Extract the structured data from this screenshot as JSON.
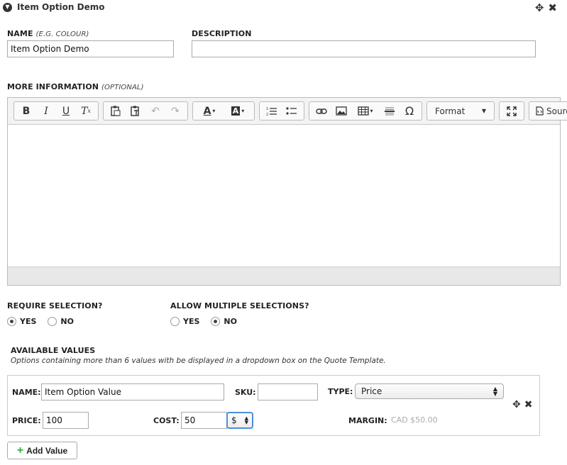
{
  "panel": {
    "title": "Item Option Demo",
    "move_icon": "✥",
    "close_icon": "✖"
  },
  "name_field": {
    "label": "NAME",
    "hint": "(E.G. COLOUR)",
    "value": "Item Option Demo"
  },
  "description_field": {
    "label": "DESCRIPTION",
    "value": ""
  },
  "more_info": {
    "label": "MORE INFORMATION",
    "hint": "(OPTIONAL)"
  },
  "toolbar": {
    "format_label": "Format",
    "source_label": "Source"
  },
  "require_selection": {
    "label": "REQUIRE SELECTION?",
    "yes": "YES",
    "no": "NO",
    "selected": "YES"
  },
  "allow_multiple": {
    "label": "ALLOW MULTIPLE SELECTIONS?",
    "yes": "YES",
    "no": "NO",
    "selected": "NO"
  },
  "available_values": {
    "title": "AVAILABLE VALUES",
    "help": "Options containing more than 6 values with be displayed in a dropdown box on the Quote Template.",
    "rows": [
      {
        "name_label": "NAME:",
        "name": "Item Option Value",
        "sku_label": "SKU:",
        "sku": "",
        "type_label": "TYPE:",
        "type": "Price",
        "price_label": "PRICE:",
        "price": "100",
        "cost_label": "COST:",
        "cost": "50",
        "currency": "$",
        "margin_label": "MARGIN:",
        "margin": "CAD $50.00"
      }
    ]
  },
  "add_value_label": "Add Value",
  "colors": {
    "accent_green": "#2bb24c",
    "focus_blue": "#4a90d9"
  }
}
